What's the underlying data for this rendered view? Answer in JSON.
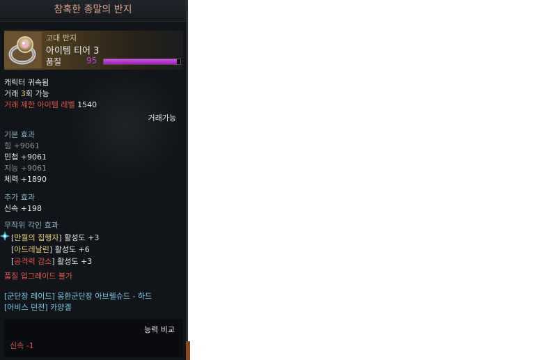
{
  "tooltip": {
    "title": "참혹한 종말의 반지",
    "grade": "고대 반지",
    "tier": "아이템 티어 3",
    "quality_label": "품질",
    "quality_value": "95",
    "quality_fraction": 0.95,
    "bound": "캐릭터 귀속됨",
    "trade_prefix": "거래 ",
    "trade_count": "3",
    "trade_suffix": "회 가능",
    "trade_level_label": "거래 제한 아이템 레벨",
    "trade_level_value": "1540",
    "tradable": "거래가능",
    "basic_header": "기본 효과",
    "basic": [
      "힘 +9061",
      "민첩 +9061",
      "지능 +9061",
      "체력 +1890"
    ],
    "extra_header": "추가 효과",
    "extra": [
      "신속 +198"
    ],
    "engrave_header": "무작위 각인 효과",
    "engravings": [
      {
        "name": "만월의 집행자",
        "value": "활성도 +3"
      },
      {
        "name": "아드레날린",
        "value": "활성도 +6"
      },
      {
        "name": "공격력 감소",
        "value": "활성도 +3"
      }
    ],
    "no_upgrade": "품질 업그레이드 불가",
    "sources": [
      "[군단장 레이드] 몽환군단장 아브렐슈드 - 하드",
      "[어비스 던전] 카양겔"
    ],
    "compare_title": "능력 비교",
    "compare_stat": "신속 -1"
  },
  "colors": {
    "title": "#e0a48e",
    "quality": "#c24adb",
    "section": "#8fb6c8",
    "warn": "#e0544a",
    "link": "#7fc9ea",
    "engrave1": "#e8d27a",
    "engrave2": "#e8d27a",
    "engrave3": "#e0544a"
  },
  "icons": [
    "ring-icon",
    "gem-icon"
  ]
}
